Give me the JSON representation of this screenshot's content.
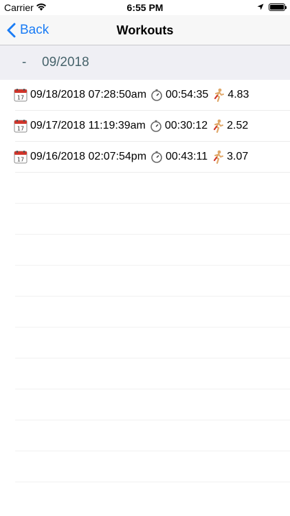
{
  "status_bar": {
    "carrier": "Carrier",
    "time": "6:55 PM"
  },
  "nav": {
    "back_label": "Back",
    "title": "Workouts"
  },
  "section": {
    "dash": "-",
    "month": "09/2018"
  },
  "workouts": [
    {
      "datetime": "09/18/2018 07:28:50am",
      "duration": "00:54:35",
      "distance": "4.83"
    },
    {
      "datetime": "09/17/2018 11:19:39am",
      "duration": "00:30:12",
      "distance": "2.52"
    },
    {
      "datetime": "09/16/2018 02:07:54pm",
      "duration": "00:43:11",
      "distance": "3.07"
    }
  ],
  "colors": {
    "accent": "#1a7cf5",
    "section_bg": "#efeff4",
    "section_text": "#46636b"
  }
}
